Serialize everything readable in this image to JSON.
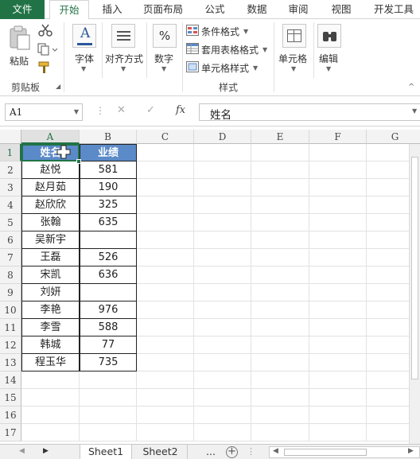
{
  "ribbon_tabs": [
    "文件",
    "开始",
    "插入",
    "页面布局",
    "公式",
    "数据",
    "审阅",
    "视图",
    "开发工具"
  ],
  "clipboard": {
    "paste_label": "粘贴",
    "group_label": "剪贴板"
  },
  "font": {
    "label": "字体"
  },
  "alignment": {
    "label": "对齐方式"
  },
  "number": {
    "label": "数字",
    "percent_symbol": "%"
  },
  "styles": {
    "conditional_format": "条件格式",
    "table_format": "套用表格格式",
    "cell_styles": "单元格样式",
    "group_label": "样式"
  },
  "cells": {
    "label": "单元格"
  },
  "editing": {
    "label": "编辑"
  },
  "formula_bar": {
    "name_box": "A1",
    "fx_label": "fx",
    "content": "姓名",
    "cancel_symbol": "✕",
    "enter_symbol": "✓"
  },
  "columns": [
    "A",
    "B",
    "C",
    "D",
    "E",
    "F",
    "G"
  ],
  "rows": [
    "1",
    "2",
    "3",
    "4",
    "5",
    "6",
    "7",
    "8",
    "9",
    "10",
    "11",
    "12",
    "13",
    "14",
    "15",
    "16",
    "17"
  ],
  "table": {
    "headers": [
      "姓名",
      "业绩"
    ],
    "data": [
      [
        "赵悦",
        "581"
      ],
      [
        "赵月茹",
        "190"
      ],
      [
        "赵欣欣",
        "325"
      ],
      [
        "张翰",
        "635"
      ],
      [
        "吴新宇",
        ""
      ],
      [
        "王磊",
        "526"
      ],
      [
        "宋凯",
        "636"
      ],
      [
        "刘妍",
        ""
      ],
      [
        "李艳",
        "976"
      ],
      [
        "李雪",
        "588"
      ],
      [
        "韩城",
        "77"
      ],
      [
        "程玉华",
        "735"
      ]
    ]
  },
  "sheets": [
    "Sheet1",
    "Sheet2"
  ],
  "sheet_more": "...",
  "colors": {
    "accent": "#217346",
    "header_fill": "#5b8ac8"
  }
}
